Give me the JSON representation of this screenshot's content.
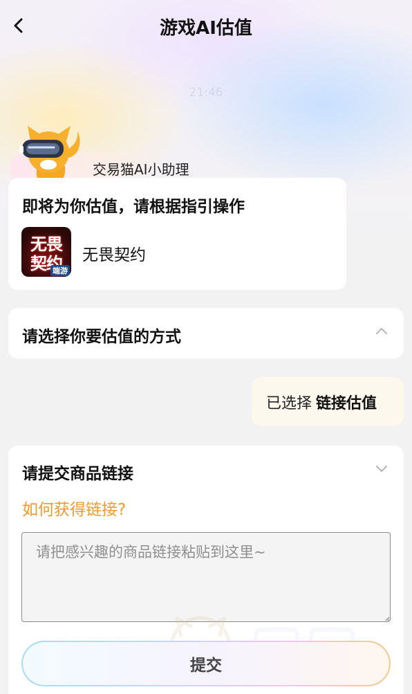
{
  "header": {
    "title": "游戏AI估值",
    "back_icon": "chevron-left-icon"
  },
  "faint_time": "21:46",
  "assistant": {
    "name": "交易猫AI小助理",
    "avatar_icon": "cat-mascot-with-vr-goggles"
  },
  "intro_card": {
    "title": "即将为你估值，请根据指引操作",
    "game": {
      "name": "无畏契约",
      "icon_line1": "无畏",
      "icon_line2": "契约",
      "icon_tag": "端游"
    }
  },
  "method_card": {
    "title": "请选择你要估值的方式",
    "chevron": "chevron-up-icon"
  },
  "selection_bubble": {
    "prefix": "已选择",
    "value": "链接估值"
  },
  "link_card": {
    "title": "请提交商品链接",
    "chevron": "chevron-down-icon",
    "help_link": "如何获得链接?",
    "input": {
      "placeholder": "请把感兴趣的商品链接粘贴到这里~",
      "value": ""
    },
    "submit_label": "提交"
  },
  "colors": {
    "accent_orange": "#f19a2c",
    "selected_bubble_bg": "#fdf8ee",
    "page_bg": "#f2f2f2"
  }
}
